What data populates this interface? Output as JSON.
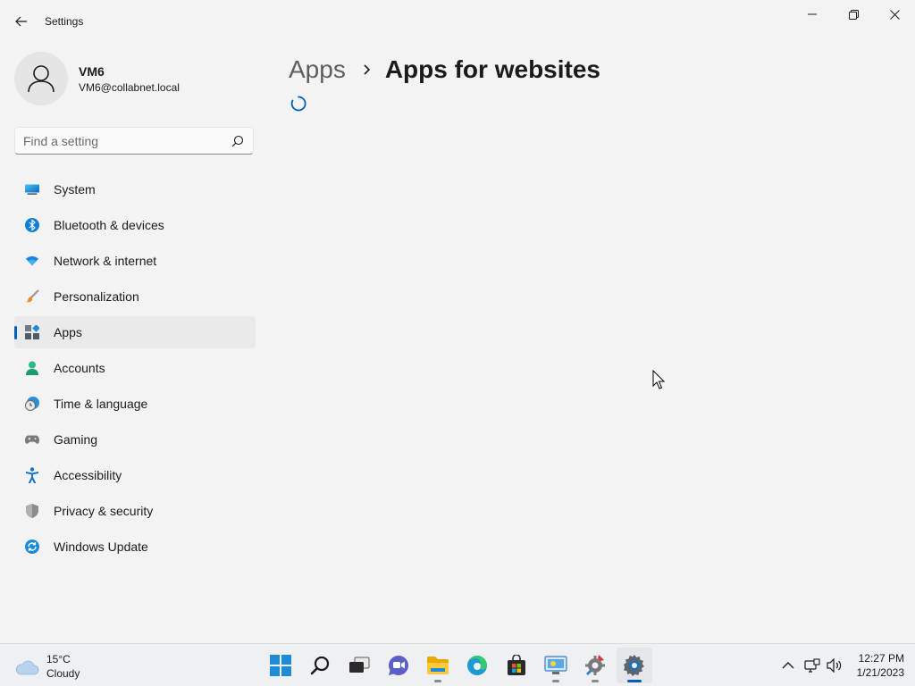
{
  "window": {
    "title": "Settings"
  },
  "profile": {
    "name": "VM6",
    "email": "VM6@collabnet.local"
  },
  "search": {
    "placeholder": "Find a setting"
  },
  "sidebar": {
    "items": [
      {
        "label": "System",
        "icon": "system-icon",
        "active": false
      },
      {
        "label": "Bluetooth & devices",
        "icon": "bluetooth-icon",
        "active": false
      },
      {
        "label": "Network & internet",
        "icon": "wifi-icon",
        "active": false
      },
      {
        "label": "Personalization",
        "icon": "brush-icon",
        "active": false
      },
      {
        "label": "Apps",
        "icon": "apps-icon",
        "active": true
      },
      {
        "label": "Accounts",
        "icon": "person-icon",
        "active": false
      },
      {
        "label": "Time & language",
        "icon": "clock-globe-icon",
        "active": false
      },
      {
        "label": "Gaming",
        "icon": "gamepad-icon",
        "active": false
      },
      {
        "label": "Accessibility",
        "icon": "accessibility-icon",
        "active": false
      },
      {
        "label": "Privacy & security",
        "icon": "shield-icon",
        "active": false
      },
      {
        "label": "Windows Update",
        "icon": "update-icon",
        "active": false
      }
    ]
  },
  "main": {
    "breadcrumb_parent": "Apps",
    "page_title": "Apps for websites",
    "loading": true
  },
  "taskbar": {
    "weather_temp": "15°C",
    "weather_condition": "Cloudy",
    "apps": [
      "start",
      "search",
      "task-view",
      "chat",
      "file-explorer",
      "edge",
      "store",
      "remote-desktop",
      "tools",
      "settings"
    ],
    "time": "12:27 PM",
    "date": "1/21/2023"
  },
  "colors": {
    "accent": "#005fb8",
    "background": "#f3f3f3"
  }
}
